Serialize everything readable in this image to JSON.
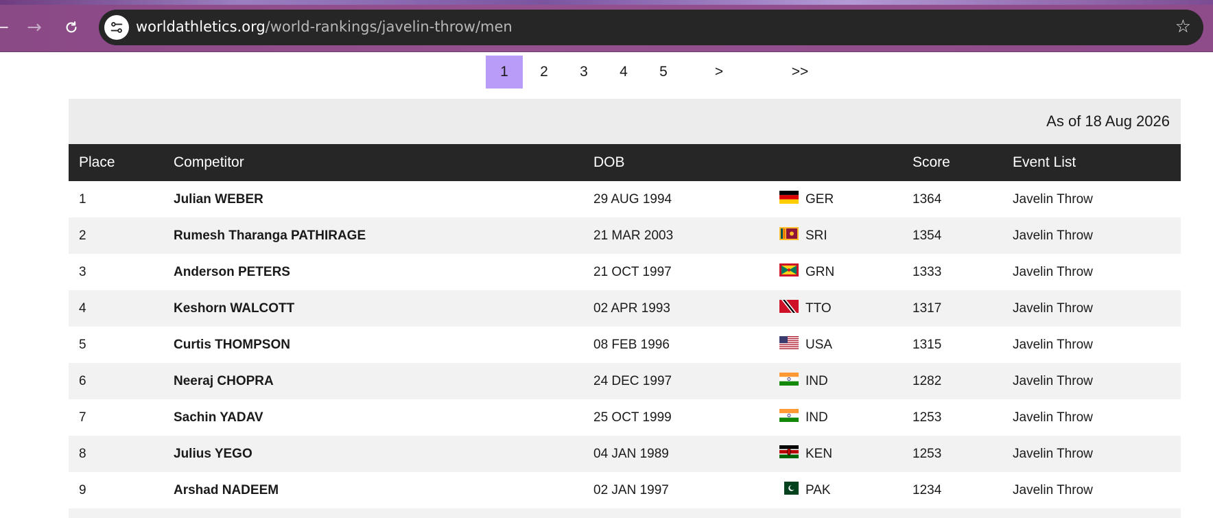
{
  "browser": {
    "url_host": "worldathletics.org",
    "url_path": "/world-rankings/javelin-throw/men"
  },
  "pagination": {
    "pages": [
      "1",
      "2",
      "3",
      "4",
      "5"
    ],
    "active": "1",
    "next": ">",
    "last": ">>"
  },
  "table": {
    "as_of": "As of 18 Aug 2026",
    "headers": {
      "place": "Place",
      "competitor": "Competitor",
      "dob": "DOB",
      "score": "Score",
      "event_list": "Event List"
    },
    "rows": [
      {
        "place": "1",
        "competitor": "Julian WEBER",
        "dob": "29 AUG 1994",
        "flag": "germany-flag",
        "nat": "GER",
        "score": "1364",
        "event": "Javelin Throw"
      },
      {
        "place": "2",
        "competitor": "Rumesh Tharanga PATHIRAGE",
        "dob": "21 MAR 2003",
        "flag": "sri-lanka-flag",
        "nat": "SRI",
        "score": "1354",
        "event": "Javelin Throw"
      },
      {
        "place": "3",
        "competitor": "Anderson PETERS",
        "dob": "21 OCT 1997",
        "flag": "grenada-flag",
        "nat": "GRN",
        "score": "1333",
        "event": "Javelin Throw"
      },
      {
        "place": "4",
        "competitor": "Keshorn WALCOTT",
        "dob": "02 APR 1993",
        "flag": "trinidad-tobago-flag",
        "nat": "TTO",
        "score": "1317",
        "event": "Javelin Throw"
      },
      {
        "place": "5",
        "competitor": "Curtis THOMPSON",
        "dob": "08 FEB 1996",
        "flag": "usa-flag",
        "nat": "USA",
        "score": "1315",
        "event": "Javelin Throw"
      },
      {
        "place": "6",
        "competitor": "Neeraj CHOPRA",
        "dob": "24 DEC 1997",
        "flag": "india-flag",
        "nat": "IND",
        "score": "1282",
        "event": "Javelin Throw"
      },
      {
        "place": "7",
        "competitor": "Sachin YADAV",
        "dob": "25 OCT 1999",
        "flag": "india-flag",
        "nat": "IND",
        "score": "1253",
        "event": "Javelin Throw"
      },
      {
        "place": "8",
        "competitor": "Julius YEGO",
        "dob": "04 JAN 1989",
        "flag": "kenya-flag",
        "nat": "KEN",
        "score": "1253",
        "event": "Javelin Throw"
      },
      {
        "place": "9",
        "competitor": "Arshad NADEEM",
        "dob": "02 JAN 1997",
        "flag": "pakistan-flag",
        "nat": "PAK",
        "score": "1234",
        "event": "Javelin Throw"
      }
    ]
  },
  "colors": {
    "pager_active": "#b89cf7",
    "header_bg": "#262626",
    "asof_bg": "#ececec",
    "row_alt": "#f2f2f2"
  }
}
